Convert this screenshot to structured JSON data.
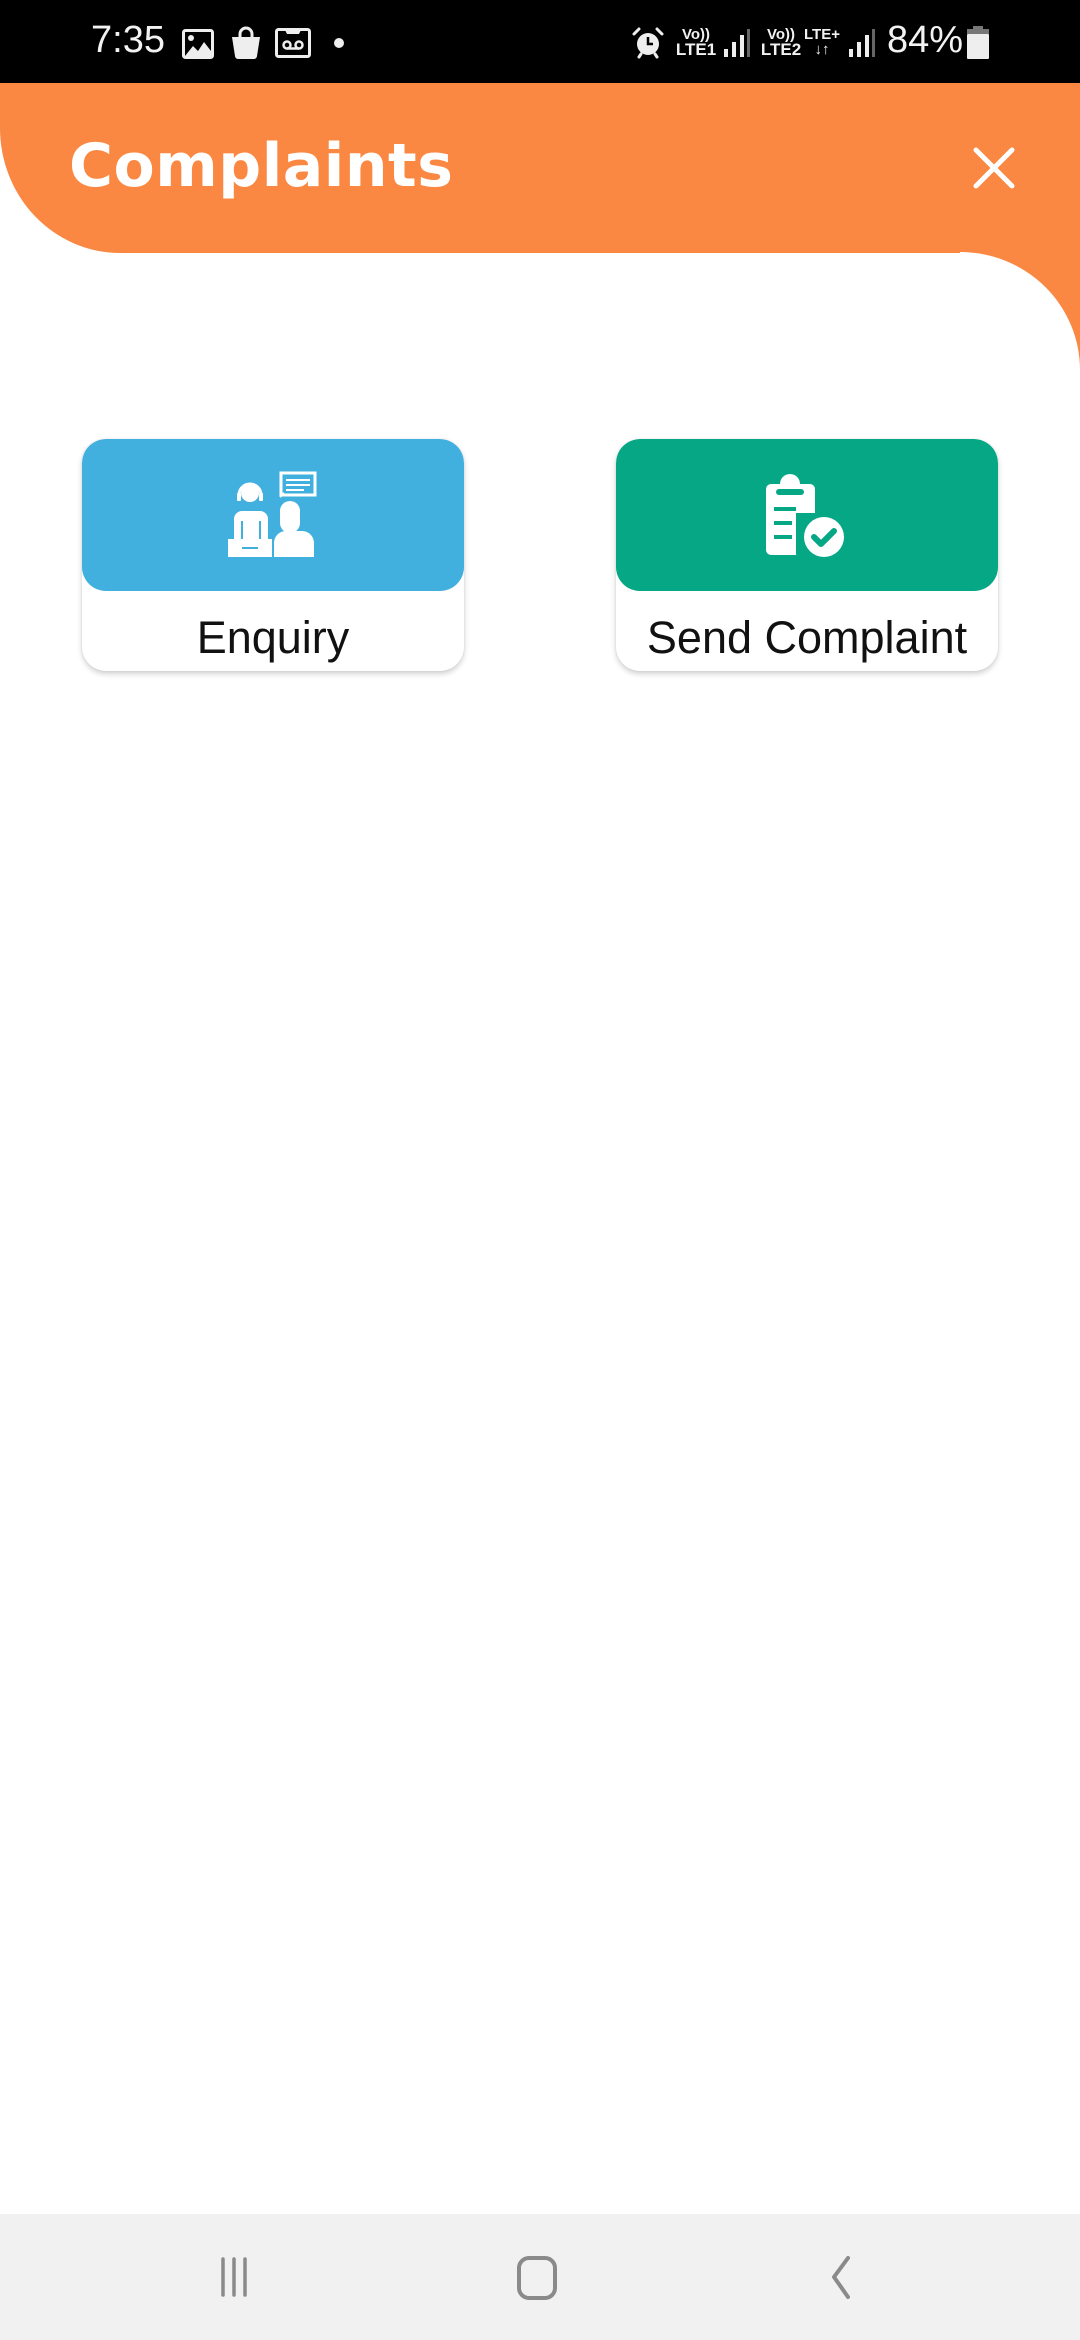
{
  "status_bar": {
    "time": "7:35",
    "left_icons": [
      "gallery-icon",
      "shopping-bag-icon",
      "voicemail-icon",
      "notification-dot-icon"
    ],
    "right_icons": [
      "alarm-icon",
      "volte-lte1-icon",
      "signal-1-icon",
      "volte-lte2-icon",
      "lte-plus-data-icon",
      "signal-2-icon",
      "battery-icon"
    ],
    "sim1_label_top": "Vo))",
    "sim1_label_bottom": "LTE1",
    "sim2_label_top": "Vo))",
    "sim2_label_bottom": "LTE2",
    "data_label": "LTE+",
    "data_arrows": "↓↑",
    "battery_percent": "84%"
  },
  "header": {
    "title": "Complaints",
    "close_icon": "close-icon",
    "color": "#FA8842"
  },
  "options": [
    {
      "label": "Enquiry",
      "icon": "customer-support-icon",
      "color": "#42B0DE"
    },
    {
      "label": "Send Complaint",
      "icon": "clipboard-check-icon",
      "color": "#05A785"
    }
  ],
  "nav_bar": {
    "buttons": [
      "recent-apps-icon",
      "home-icon",
      "back-icon"
    ]
  }
}
